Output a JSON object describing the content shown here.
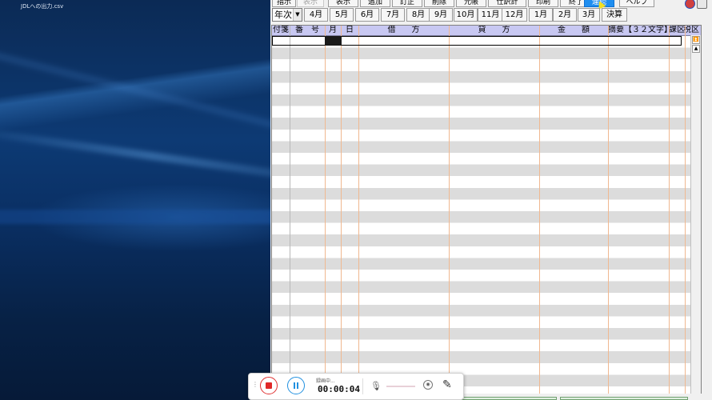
{
  "desktop": {
    "file_label": "JDLへの出力.csv"
  },
  "toolbar1": {
    "items": [
      {
        "label": "指示",
        "state": "normal"
      },
      {
        "label": "表示",
        "state": "disabled"
      },
      {
        "label": "表示",
        "state": "normal"
      },
      {
        "label": "追加",
        "state": "normal"
      },
      {
        "label": "訂正",
        "state": "normal"
      },
      {
        "label": "削除",
        "state": "normal"
      },
      {
        "label": "元帳",
        "state": "normal"
      },
      {
        "label": "仕訳計",
        "state": "normal"
      },
      {
        "label": "印刷",
        "state": "normal"
      },
      {
        "label": "終了",
        "state": "normal"
      },
      {
        "label": "連続",
        "state": "active"
      },
      {
        "label": "ヘルプ",
        "state": "normal"
      }
    ]
  },
  "period_bar": {
    "selected": "年次",
    "months": [
      "4月",
      "5月",
      "6月",
      "7月",
      "8月",
      "9月",
      "10月",
      "11月",
      "12月",
      "1月",
      "2月",
      "3月"
    ],
    "closing": "決算"
  },
  "grid": {
    "columns": [
      "付箋",
      "番　号",
      "月",
      "日",
      "借　　方",
      "貸　　方",
      "金　　額",
      "摘要【３２文字】",
      "課区",
      "税区"
    ],
    "row_count": 31,
    "selected_row": 1
  },
  "recorder": {
    "status": "録画中...",
    "time": "00:00:04"
  },
  "colors": {
    "header_bg": "#c8c8f2",
    "alt_row": "#dcdcdc",
    "column_line": "#f0b890",
    "active_button": "#1f8ef0",
    "record_red": "#e02828",
    "pause_blue": "#2090e0"
  }
}
